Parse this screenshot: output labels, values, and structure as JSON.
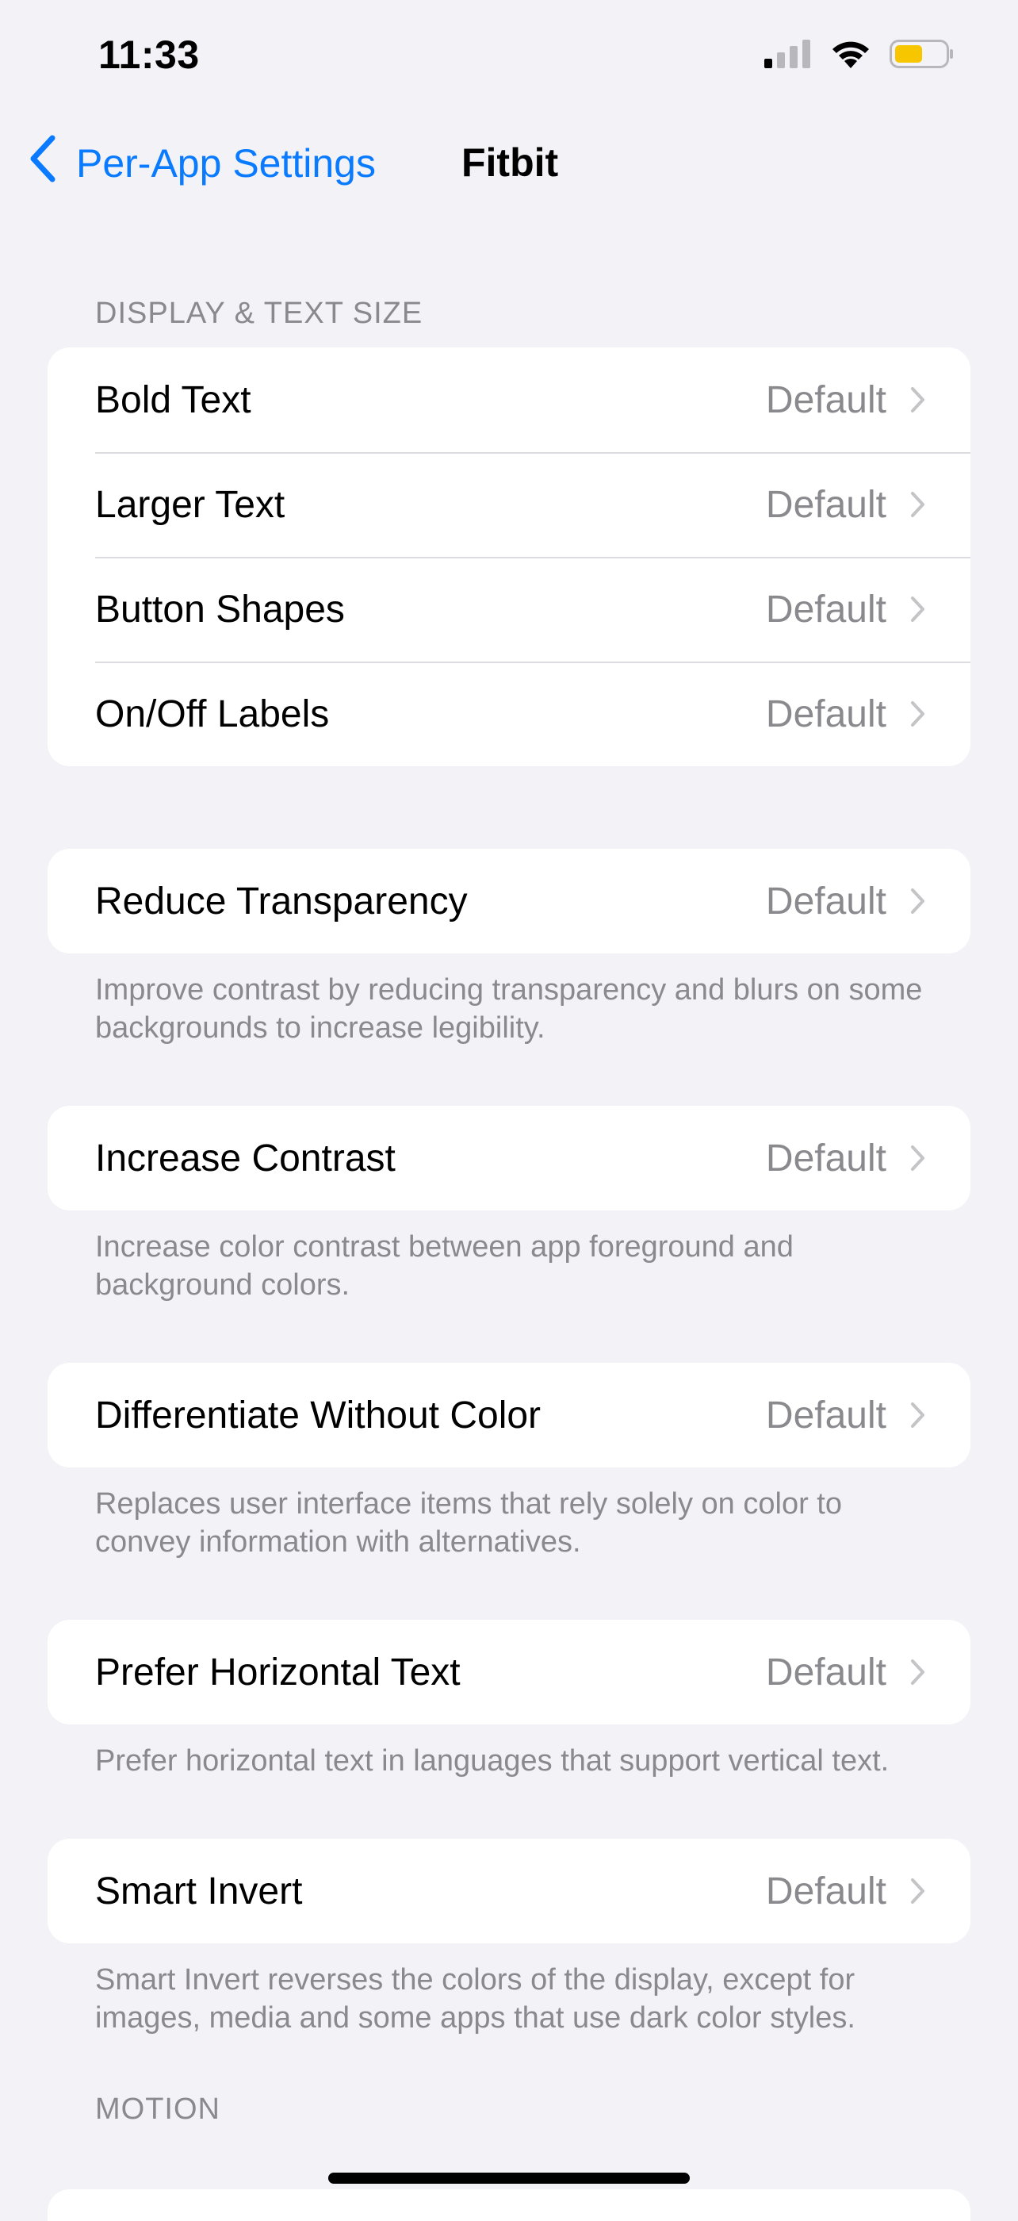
{
  "status_bar": {
    "time": "11:33",
    "battery_color": "#f7c600"
  },
  "nav": {
    "back_label": "Per-App Settings",
    "title": "Fitbit",
    "accent_color": "#0a7aff"
  },
  "sections": {
    "display_header": "DISPLAY & TEXT SIZE",
    "display_rows": [
      {
        "label": "Bold Text",
        "value": "Default"
      },
      {
        "label": "Larger Text",
        "value": "Default"
      },
      {
        "label": "Button Shapes",
        "value": "Default"
      },
      {
        "label": "On/Off Labels",
        "value": "Default"
      }
    ],
    "reduce_transparency": {
      "label": "Reduce Transparency",
      "value": "Default",
      "footer": "Improve contrast by reducing transparency and blurs on some backgrounds to increase legibility."
    },
    "increase_contrast": {
      "label": "Increase Contrast",
      "value": "Default",
      "footer": "Increase color contrast between app foreground and background colors."
    },
    "differentiate_without_color": {
      "label": "Differentiate Without Color",
      "value": "Default",
      "footer": "Replaces user interface items that rely solely on color to convey information with alternatives."
    },
    "prefer_horizontal_text": {
      "label": "Prefer Horizontal Text",
      "value": "Default",
      "footer": "Prefer horizontal text in languages that support vertical text."
    },
    "smart_invert": {
      "label": "Smart Invert",
      "value": "Default",
      "footer": "Smart Invert reverses the colors of the display, except for images, media and some apps that use dark color styles."
    },
    "motion_header": "MOTION"
  }
}
